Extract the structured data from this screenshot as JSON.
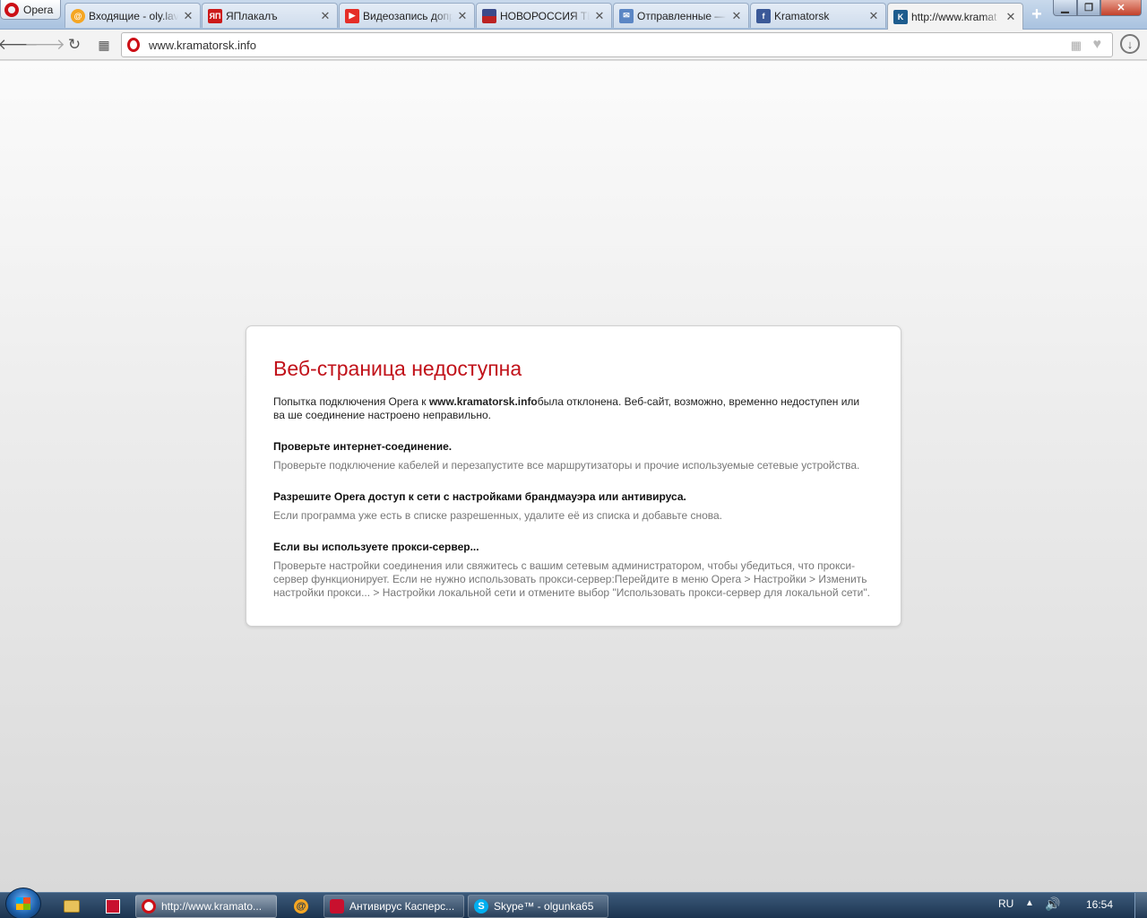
{
  "browser": {
    "menu_label": "Opera",
    "tabs": [
      {
        "title": "Входящие - oly.lav",
        "favicon": "mail-ru-icon",
        "color": "#f5a623"
      },
      {
        "title": "ЯПлакалъ",
        "favicon": "yaplakal-icon",
        "color": "#cc1a1a"
      },
      {
        "title": "Видеозапись допр",
        "favicon": "youtube-icon",
        "color": "#e52d27"
      },
      {
        "title": "НОВОРОССИЯ ТВ",
        "favicon": "flag-icon",
        "color": "#3a4a8a"
      },
      {
        "title": "Отправленные —",
        "favicon": "mail-envelope-icon",
        "color": "#5b86c4"
      },
      {
        "title": "Kramatorsk",
        "favicon": "facebook-icon",
        "color": "#3b5998"
      },
      {
        "title": "http://www.kramat",
        "favicon": "kramatorsk-icon",
        "color": "#1d5c8e"
      }
    ],
    "new_tab": "+",
    "address_url": "www.kramatorsk.info"
  },
  "error_page": {
    "title": "Веб-страница недоступна",
    "lead_before": "Попытка подключения Opera к ",
    "lead_host": "www.kramatorsk.info",
    "lead_after": "была отклонена. Веб-сайт, возможно, временно недоступен или ва ше соединение настроено неправильно.",
    "sections": [
      {
        "heading": "Проверьте интернет-соединение.",
        "text": "Проверьте подключение кабелей и перезапустите все маршрутизаторы и прочие используемые сетевые устройства."
      },
      {
        "heading": "Разрешите Opera доступ к сети с настройками брандмауэра или антивируса.",
        "text": "Если программа уже есть в списке разрешенных, удалите её из списка и добавьте снова."
      },
      {
        "heading": "Если вы используете прокси-сервер...",
        "text": "Проверьте настройки соединения или свяжитесь с вашим сетевым администратором, чтобы убедиться, что прокси-сервер функционирует. Если не нужно использовать прокси-сервер:Перейдите в меню Opera > Настройки > Изменить настройки прокси... > Настройки локальной сети и отмените выбор \"Использовать прокси-сервер для локальной сети\"."
      }
    ]
  },
  "taskbar": {
    "items": [
      {
        "label": "http://www.kramato...",
        "icon": "opera-icon",
        "color": "#cc0f16"
      },
      {
        "label": "Антивирус Касперс...",
        "icon": "kaspersky-icon",
        "color": "#c8102e"
      },
      {
        "label": "Skype™ - olgunka65",
        "icon": "skype-icon",
        "color": "#00aff0"
      }
    ],
    "language": "RU",
    "clock": "16:54"
  }
}
